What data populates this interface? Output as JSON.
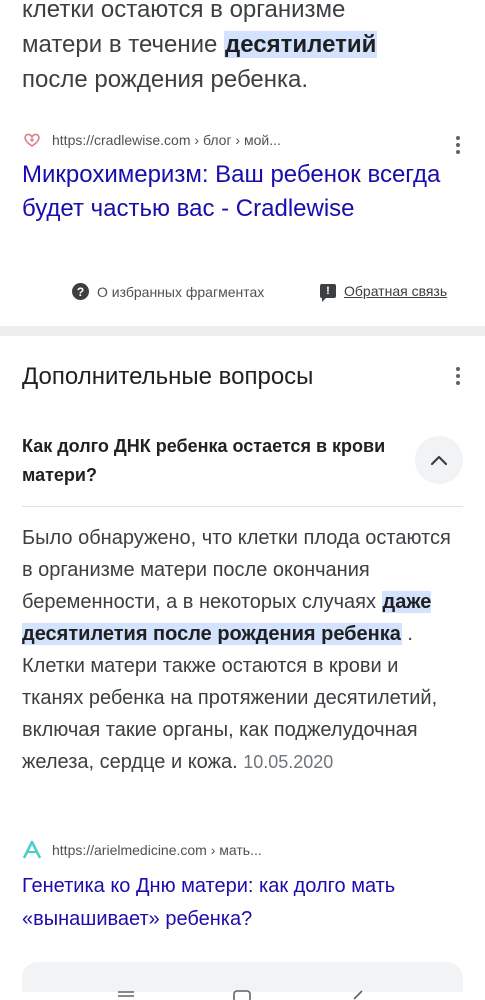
{
  "snippet": {
    "line1": "клетки остаются в организме",
    "line2_pre": "матери в течение ",
    "highlight": "десятилетий",
    "line3": "после рождения ребенка."
  },
  "result1": {
    "url": "https://cradlewise.com › блог › мой...",
    "title": "Микрохимеризм: Ваш ребенок всегда будет частью вас - Cradlewise",
    "favicon": "heart-favicon-icon"
  },
  "footer": {
    "about": "О избранных фрагментах",
    "feedback": "Обратная связь"
  },
  "related": {
    "title": "Дополнительные вопросы",
    "question": "Как долго ДНК ребенка остается в крови матери?",
    "answer_pre": "Было обнаружено, что клетки плода остаются в организме матери после окончания беременности, а в некоторых случаях ",
    "answer_highlight": "даже десятилетия после рождения ребенка",
    "answer_post": " . Клетки матери также остаются в крови и тканях ребенка на протяжении десятилетий, включая такие органы, как поджелудочная железа, сердце и кожа. ",
    "date": "10.05.2020"
  },
  "result2": {
    "url": "https://arielmedicine.com › мать...",
    "title": "Генетика ко Дню матери: как долго мать «вынашивает» ребенка?",
    "favicon_letter": "A",
    "favicon_color": "#4dd0c8"
  },
  "icons": {
    "about": "?",
    "feedback": "!"
  }
}
